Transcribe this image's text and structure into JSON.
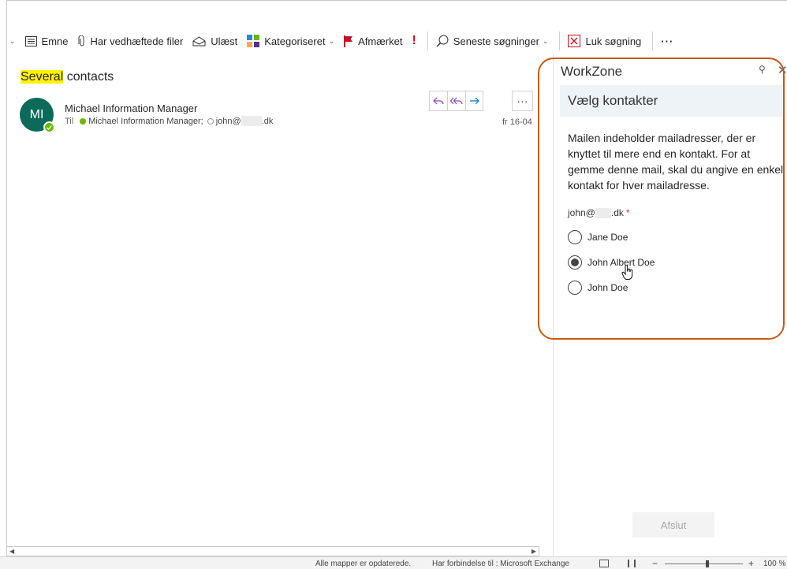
{
  "toolbar": {
    "subject_label": "Emne",
    "attachments_label": "Har vedhæftede filer",
    "unread_label": "Ulæst",
    "categorized_label": "Kategoriseret",
    "flagged_label": "Afmærket",
    "recent_searches_label": "Seneste søgninger",
    "close_search_label": "Luk søgning",
    "more_label": "···"
  },
  "message": {
    "subject_highlight": "Several",
    "subject_rest": " contacts",
    "avatar_initials": "MI",
    "sender": "Michael Information Manager",
    "to_label": "Til",
    "recipient1": "Michael Information Manager;",
    "recipient2_prefix": "john@",
    "recipient2_suffix": ".dk",
    "date": "fr 16-04",
    "more_label": "···"
  },
  "addin": {
    "title": "WorkZone",
    "header": "Vælg kontakter",
    "description": "Mailen indeholder mailadresser, der er knyttet til mere end en kontakt. For at gemme denne mail, skal du angive en enkel kontakt for hver mailadresse.",
    "email_prefix": "john@",
    "email_suffix": ".dk",
    "required_mark": "*",
    "options": [
      {
        "label": "Jane Doe",
        "selected": false
      },
      {
        "label": "John Albert Doe",
        "selected": true
      },
      {
        "label": "John Doe",
        "selected": false
      }
    ],
    "finish_label": "Afslut"
  },
  "status": {
    "text1": "Alle mapper er opdaterede.",
    "text2": "Har forbindelse til : Microsoft Exchange",
    "zoom_minus": "−",
    "zoom_plus": "+",
    "zoom": "100 %"
  },
  "colors": {
    "avatar": "#0b6a5a",
    "presence": "#6bb700",
    "accent_ring": "#c55a11",
    "highlight": "#fff100",
    "header_bg": "#eef3f8"
  }
}
